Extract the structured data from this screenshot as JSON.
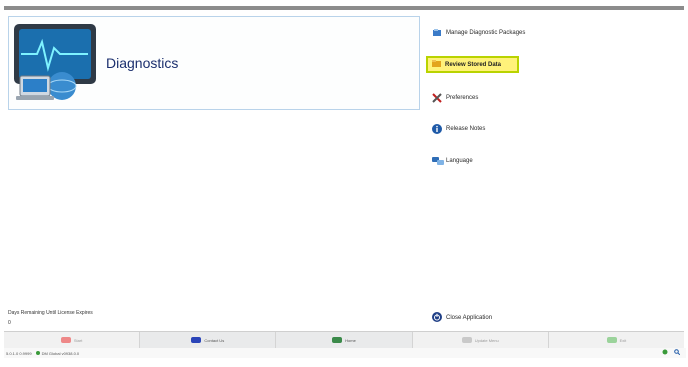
{
  "header": {
    "title": "Diagnostics"
  },
  "menu": {
    "manage": "Manage Diagnostic Packages",
    "review": "Review Stored Data",
    "preferences": "Preferences",
    "release_notes": "Release Notes",
    "language": "Language",
    "close": "Close Application"
  },
  "license": {
    "label": "Days Remaining Until License Expires",
    "count": "0"
  },
  "bottom_nav": {
    "start": "Start",
    "contact": "Contact Us",
    "home": "Home",
    "update": "Update Menu",
    "exit": "Exit"
  },
  "status": {
    "version": "5.0.1.0 0.9999",
    "connection": "DM Global v0938.0.0"
  },
  "colors": {
    "accent_highlight": "#fff27a",
    "title_blue": "#1b2f6e"
  }
}
